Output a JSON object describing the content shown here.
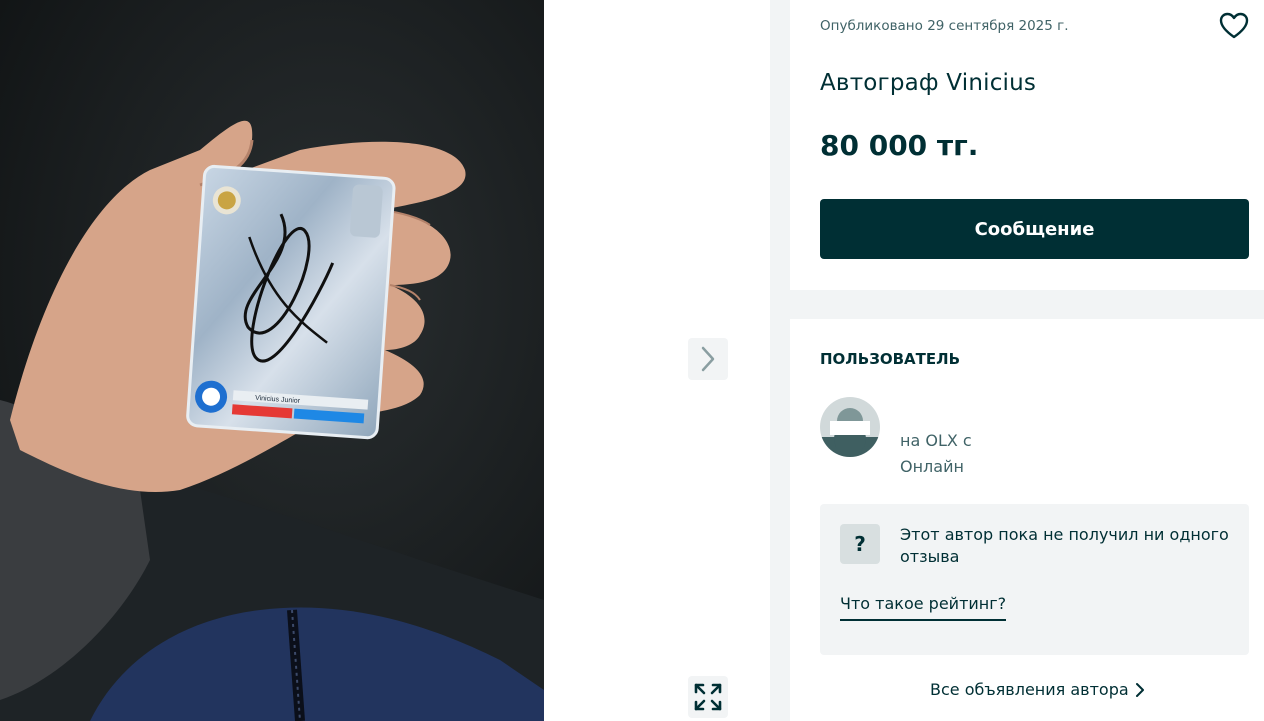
{
  "listing": {
    "published": "Опубликовано 29 сентября 2025 г.",
    "title": "Автограф Vinicius",
    "price": "80 000 тг.",
    "message_button": "Сообщение"
  },
  "user": {
    "section_title": "ПОЛЬЗОВАТЕЛЬ",
    "member_since": "на OLX с",
    "status": "Онлайн",
    "rating_text": "Этот автор пока не получил ни одного отзыва",
    "rating_badge": "?",
    "rating_link": "Что такое рейтинг?",
    "all_ads": "Все объявления автора"
  },
  "card_in_photo": {
    "player_name": "Vinicius Junior"
  },
  "icons": {
    "heart": "heart-icon",
    "next": "chevron-right-icon",
    "expand": "expand-icon",
    "all_ads_chevron": "chevron-right-icon"
  },
  "colors": {
    "brand_dark": "#002f34",
    "muted_text": "#406367",
    "page_bg": "#f2f4f5"
  }
}
